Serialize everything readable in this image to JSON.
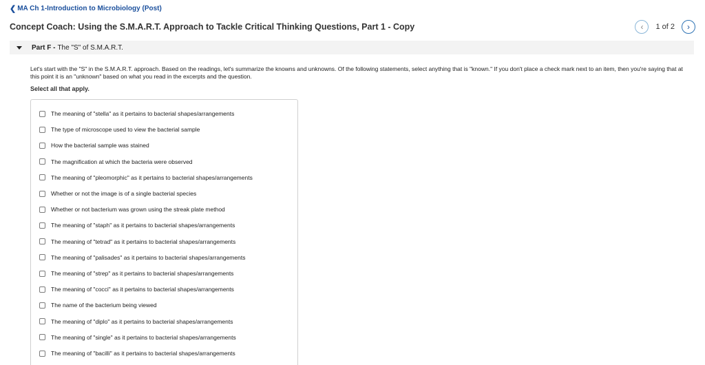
{
  "header": {
    "back_chevron": "chevron-left-icon",
    "back_label": "MA Ch 1-Introduction to Microbiology (Post)",
    "title": "Concept Coach: Using the S.M.A.R.T. Approach to Tackle Critical Thinking Questions, Part 1 - Copy",
    "pager": {
      "prev_icon": "chevron-left-icon",
      "count": "1 of 2",
      "next_icon": "chevron-right-icon"
    }
  },
  "part": {
    "expand_icon": "triangle-down-icon",
    "label": "Part F -",
    "name": "The \"S\" of S.M.A.R.T."
  },
  "instructions": "Let's start with the \"S\" in the S.M.A.R.T. approach. Based on the readings, let's summarize the knowns and unknowns. Of the following statements, select anything that is \"known.\" If you don't place a check mark next to an item, then you're saying that at this point it is an \"unknown\" based on what you read in the excerpts and the question.",
  "select_all_label": "Select all that apply.",
  "options": [
    {
      "label": "The meaning of \"stella\" as it pertains to bacterial shapes/arrangements",
      "checked": false
    },
    {
      "label": "The type of microscope used to view the bacterial sample",
      "checked": false
    },
    {
      "label": "How the bacterial sample was stained",
      "checked": false
    },
    {
      "label": "The magnification at which the bacteria were observed",
      "checked": false
    },
    {
      "label": "The meaning of \"pleomorphic\" as it pertains to bacterial shapes/arrangements",
      "checked": false
    },
    {
      "label": "Whether or not the image is of a single bacterial species",
      "checked": false
    },
    {
      "label": "Whether or not bacterium was grown using the streak plate method",
      "checked": false
    },
    {
      "label": "The meaning of \"staph\" as it pertains to bacterial shapes/arrangements",
      "checked": false
    },
    {
      "label": "The meaning of \"tetrad\" as it pertains to bacterial shapes/arrangements",
      "checked": false
    },
    {
      "label": "The meaning of \"palisades\" as it pertains to bacterial shapes/arrangements",
      "checked": false
    },
    {
      "label": "The meaning of \"strep\" as it pertains to bacterial shapes/arrangements",
      "checked": false
    },
    {
      "label": "The meaning of \"cocci\" as it pertains to bacterial shapes/arrangements",
      "checked": false
    },
    {
      "label": "The name of the bacterium being viewed",
      "checked": false
    },
    {
      "label": "The meaning of \"diplo\" as it pertains to bacterial shapes/arrangements",
      "checked": false
    },
    {
      "label": "The meaning of \"single\" as it pertains to bacterial shapes/arrangements",
      "checked": false
    },
    {
      "label": "The meaning of \"bacilli\" as it pertains to bacterial shapes/arrangements",
      "checked": false
    }
  ]
}
